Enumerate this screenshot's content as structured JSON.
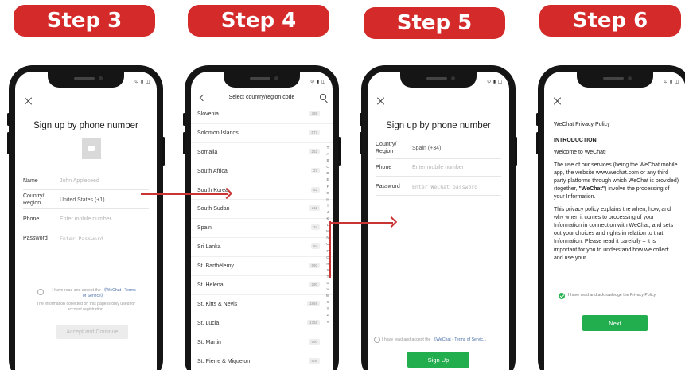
{
  "steps": [
    "Step 3",
    "Step 4",
    "Step 5",
    "Step 6"
  ],
  "status_bar": "⊙ ▮ ◫",
  "screen3": {
    "title": "Sign up by phone number",
    "rows": [
      {
        "label": "Name",
        "value": "John Appleseed",
        "placeholder": true
      },
      {
        "label": "Country/\nRegion",
        "value": "United States (+1)",
        "placeholder": false
      },
      {
        "label": "Phone",
        "value": "Enter mobile number",
        "placeholder": true
      },
      {
        "label": "Password",
        "value": "Enter Password",
        "placeholder": true
      }
    ],
    "agree_text": "I have read and accept the",
    "agree_link": "《WeChat - Terms of Service》",
    "info_text": "The information collected on this page is only used for account registration.",
    "button": "Accept and Continue"
  },
  "screen4": {
    "title": "Select country/region code",
    "countries": [
      {
        "name": "Slovenia",
        "code": "386"
      },
      {
        "name": "Solomon Islands",
        "code": "677"
      },
      {
        "name": "Somalia",
        "code": "252"
      },
      {
        "name": "South Africa",
        "code": "27"
      },
      {
        "name": "South Korea",
        "code": "82"
      },
      {
        "name": "South Sudan",
        "code": "211"
      },
      {
        "name": "Spain",
        "code": "34"
      },
      {
        "name": "Sri Lanka",
        "code": "94"
      },
      {
        "name": "St. Barthélemy",
        "code": "590"
      },
      {
        "name": "St. Helena",
        "code": "290"
      },
      {
        "name": "St. Kitts & Nevis",
        "code": "1869"
      },
      {
        "name": "St. Lucia",
        "code": "1758"
      },
      {
        "name": "St. Martin",
        "code": "590"
      },
      {
        "name": "St. Pierre & Miquelon",
        "code": "508"
      }
    ],
    "alphabet": "T A B C D E F G H I J K L M N O P Q R S T U V W X Y Z #"
  },
  "screen5": {
    "title": "Sign up by phone number",
    "rows": [
      {
        "label": "Country/\nRegion",
        "value": "Spain (+34)",
        "placeholder": false
      },
      {
        "label": "Phone",
        "value": "Enter mobile number",
        "placeholder": true
      },
      {
        "label": "Password",
        "value": "Enter WeChat password",
        "placeholder": true
      }
    ],
    "agree_text": "I have read and accept the",
    "agree_link": "《WeChat - Terms of Servic...",
    "button": "Sign Up"
  },
  "screen6": {
    "doc_title": "WeChat Privacy Policy",
    "heading": "INTRODUCTION",
    "welcome": "Welcome to WeChat!",
    "p1_pre": "The use of our services (being the WeChat mobile app, the website www.wechat.com or any third party platforms through which WeChat is provided) (together, ",
    "p1_bold": "\"WeChat\"",
    "p1_post": ") involve the processing of your Information.",
    "p2": "This privacy policy explains the when, how, and why when it comes to processing of your Information in connection with WeChat, and sets out your choices and rights in relation to that Information. Please read it carefully – it is important for you to understand how we collect and use your",
    "agree_text": "I have read and acknowledge the Privacy Policy",
    "button": "Next"
  }
}
